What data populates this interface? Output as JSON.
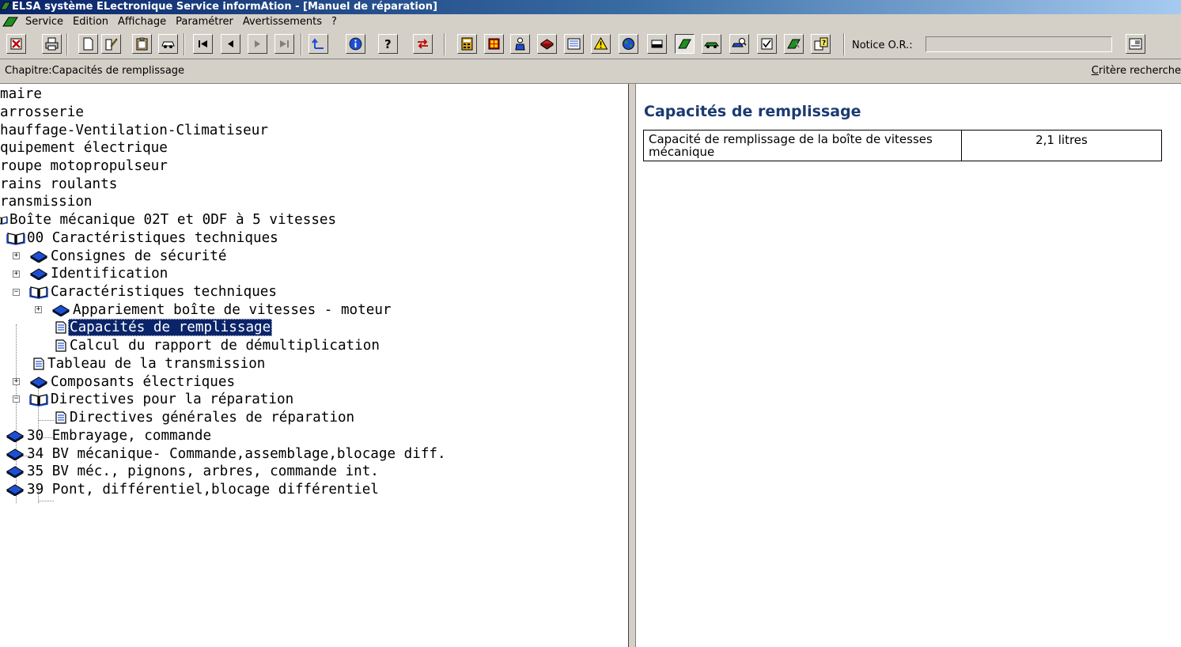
{
  "window": {
    "title": "ELSA système ELectronique Service informAtion - [Manuel de réparation]"
  },
  "menu": [
    "Service",
    "Edition",
    "Affichage",
    "Paramétrer",
    "Avertissements",
    "?"
  ],
  "toolbar": {
    "notice_label": "Notice O.R.:",
    "notice_value": ""
  },
  "chapter": {
    "label": "Chapitre:Capacités de remplissage",
    "search_prefix": "C",
    "search_rest": "ritère recherche"
  },
  "tree": [
    "maire",
    "arrosserie",
    "hauffage-Ventilation-Climatiseur",
    "quipement électrique",
    "roupe motopropulseur",
    "rains roulants",
    "ransmission",
    "Boîte mécanique 02T et 0DF à 5 vitesses",
    "00 Caractéristiques techniques",
    "Consignes de sécurité",
    "Identification",
    "Caractéristiques techniques",
    "Appariement boîte de vitesses - moteur",
    "Capacités de remplissage",
    "Calcul du rapport de démultiplication",
    "Tableau de la transmission",
    "Composants électriques",
    "Directives pour la réparation",
    "Directives générales de réparation",
    "30 Embrayage, commande",
    "34 BV mécanique- Commande,assemblage,blocage diff.",
    "35 BV méc., pignons, arbres, commande int.",
    "39 Pont, différentiel,blocage différentiel"
  ],
  "document": {
    "title": "Capacités de remplissage",
    "table": [
      {
        "label": "Capacité de remplissage de la boîte de vitesses mécanique",
        "value": "2,1 litres"
      }
    ]
  },
  "colors": {
    "title_bar": "#0a246a",
    "selection": "#0a246a",
    "doc_title": "#1a3a72",
    "chrome": "#d4d0c8"
  }
}
